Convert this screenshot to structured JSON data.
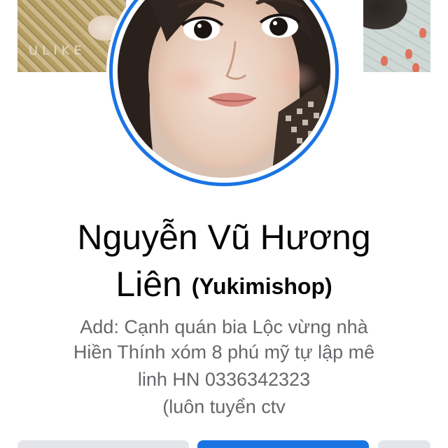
{
  "profile": {
    "cover_watermark": "ULIKE",
    "name_line1": "Nguyễn Vũ Hương",
    "name_line2": "Liên",
    "alternate_name": "(Yukimishop)",
    "bio_lines": [
      "Add: Cạnh quán bia Lộc vừng nhà",
      "Hiền Thính xóm 8 phú mỹ tự lập mê",
      "linh HN 0336342323",
      "(luôn tuyển ctv"
    ]
  },
  "colors": {
    "accent": "#1b74e4",
    "name_text": "#050505",
    "bio_text": "#65676b",
    "secondary_button": "#e4e6eb"
  },
  "icons": {
    "avatar": "profile-photo"
  }
}
